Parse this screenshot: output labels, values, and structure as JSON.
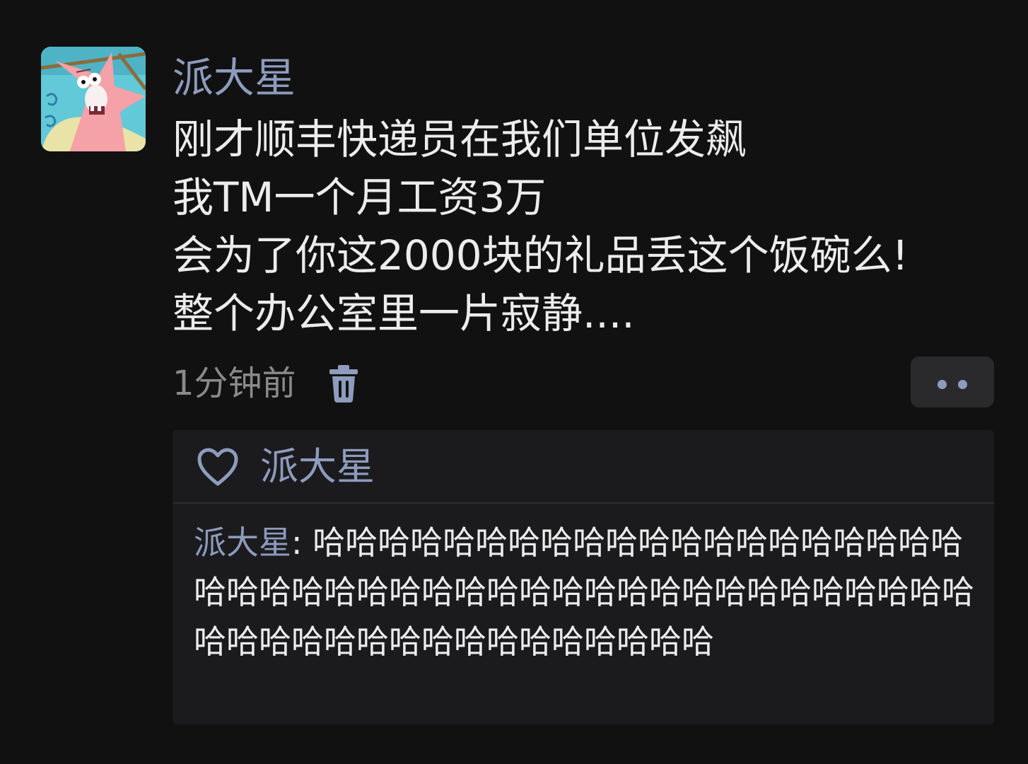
{
  "post": {
    "author": "派大星",
    "lines": [
      "刚才顺丰快递员在我们单位发飙",
      "我TM一个月工资3万",
      "会为了你这2000块的礼品丢这个饭碗么!",
      "整个办公室里一片寂静...."
    ],
    "time": "1分钟前"
  },
  "likes": {
    "names": "派大星"
  },
  "comment": {
    "author": "派大星",
    "separator": ": ",
    "text": "哈哈哈哈哈哈哈哈哈哈哈哈哈哈哈哈哈哈哈哈哈哈哈哈哈哈哈哈哈哈哈哈哈哈哈哈哈哈哈哈哈哈哈哈哈哈哈哈哈哈哈哈哈哈哈哈哈哈哈哈"
  },
  "icons": {
    "avatar": "patrick-star-avatar",
    "delete": "trash-icon",
    "more": "more-dots-icon",
    "like": "heart-icon"
  },
  "colors": {
    "background": "#111111",
    "name_link": "#8d9cbd",
    "body_text": "#ececec",
    "muted_text": "#8a8a8a",
    "panel": "#1b1b1d"
  }
}
